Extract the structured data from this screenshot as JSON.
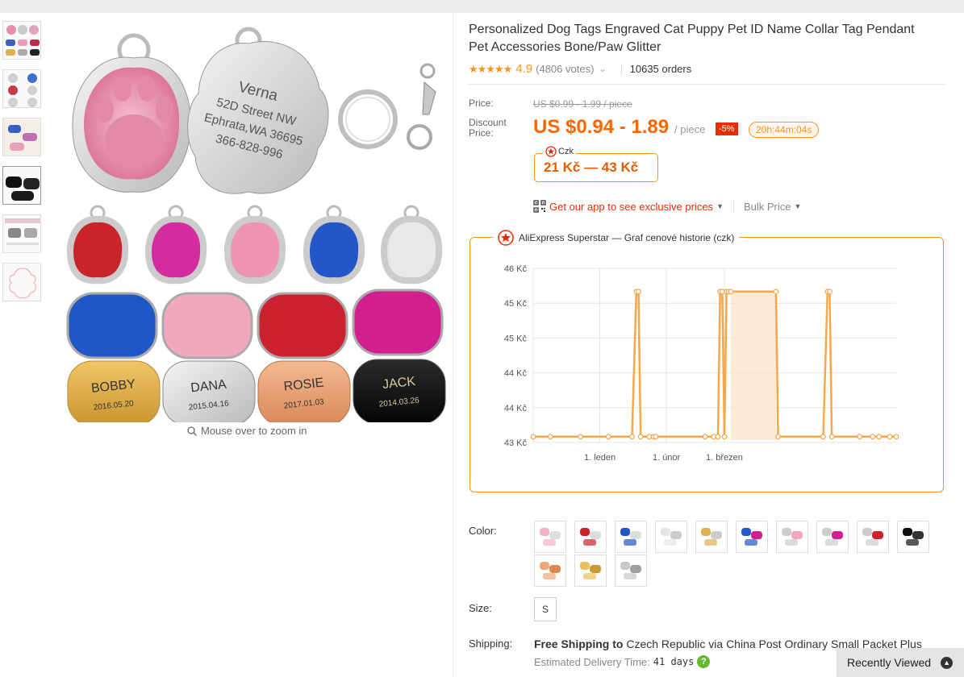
{
  "product": {
    "title": "Personalized Dog Tags Engraved Cat Puppy Pet ID Name Collar Tag Pendant Pet Accessories Bone/Paw Glitter",
    "stars": "★★★★★",
    "rating": "4.9",
    "votes": "(4806 votes)",
    "orders": "10635 orders"
  },
  "gallery": {
    "zoom_hint": "Mouse over to zoom in",
    "engraving": {
      "name": "Verna",
      "line1": "52D Street NW",
      "line2": "Ephrata,WA 36695",
      "line3": "366-828-996"
    },
    "bone_tags": [
      {
        "name": "BOBBY",
        "date": "2016.05.20"
      },
      {
        "name": "DANA",
        "date": "2015.04.16"
      },
      {
        "name": "ROSIE",
        "date": "2017.01.03"
      },
      {
        "name": "JACK",
        "date": "2014.03.26"
      }
    ]
  },
  "pricing": {
    "price_label": "Price:",
    "original": "US $0.99 - 1.99 / piece",
    "discount_label_1": "Discount",
    "discount_label_2": "Price:",
    "discount": "US $0.94 - 1.89",
    "per_piece": "/ piece",
    "badge": "-5%",
    "timer": "20h:44m:04s",
    "czk_label": "Czk",
    "czk_value": "21 Kč — 43 Kč",
    "app_link": "Get our app to see exclusive prices",
    "bulk": "Bulk Price"
  },
  "chart_data": {
    "type": "line",
    "title": "AliExpress Superstar — Graf cenové historie (czk)",
    "y_tick_labels": [
      "46 Kč",
      "45 Kč",
      "45 Kč",
      "44 Kč",
      "44 Kč",
      "43 Kč"
    ],
    "x_tick_labels": [
      "1. leden",
      "1. únor",
      "1. březen"
    ],
    "ylim": [
      43,
      46
    ],
    "series": [
      {
        "color": "#f7a64a",
        "points": [
          [
            0,
            43.1
          ],
          [
            8,
            43.1
          ],
          [
            22,
            43.1
          ],
          [
            35,
            43.1
          ],
          [
            46,
            43.1
          ],
          [
            48,
            45.6
          ],
          [
            49,
            45.6
          ],
          [
            50,
            43.1
          ],
          [
            54,
            43.1
          ],
          [
            56,
            43.1
          ],
          [
            57,
            43.1
          ],
          [
            80,
            43.1
          ],
          [
            84,
            43.1
          ],
          [
            86,
            43.1
          ],
          [
            87,
            45.6
          ],
          [
            88,
            45.6
          ],
          [
            89,
            43.1
          ],
          [
            90,
            45.6
          ],
          [
            91,
            45.6
          ],
          [
            92,
            45.6
          ],
          [
            113,
            45.6
          ],
          [
            114,
            43.1
          ],
          [
            135,
            43.1
          ],
          [
            137,
            45.6
          ],
          [
            138,
            45.6
          ],
          [
            139,
            43.1
          ],
          [
            152,
            43.1
          ],
          [
            158,
            43.1
          ],
          [
            161,
            43.1
          ],
          [
            166,
            43.1
          ],
          [
            169,
            43.1
          ]
        ]
      }
    ],
    "highlight_range": [
      92,
      113
    ],
    "grid": true,
    "legend": "none"
  },
  "options": {
    "color_label": "Color:",
    "size_label": "Size:",
    "size_value": "S",
    "shipping_label": "Shipping:",
    "shipping_bold": "Free Shipping to",
    "shipping_rest": "Czech Republic via China Post Ordinary Small Packet Plus",
    "delivery_label": "Estimated Delivery Time:",
    "delivery_days": "41 days",
    "swatch_count": 13
  },
  "recently_viewed": "Recently Viewed"
}
